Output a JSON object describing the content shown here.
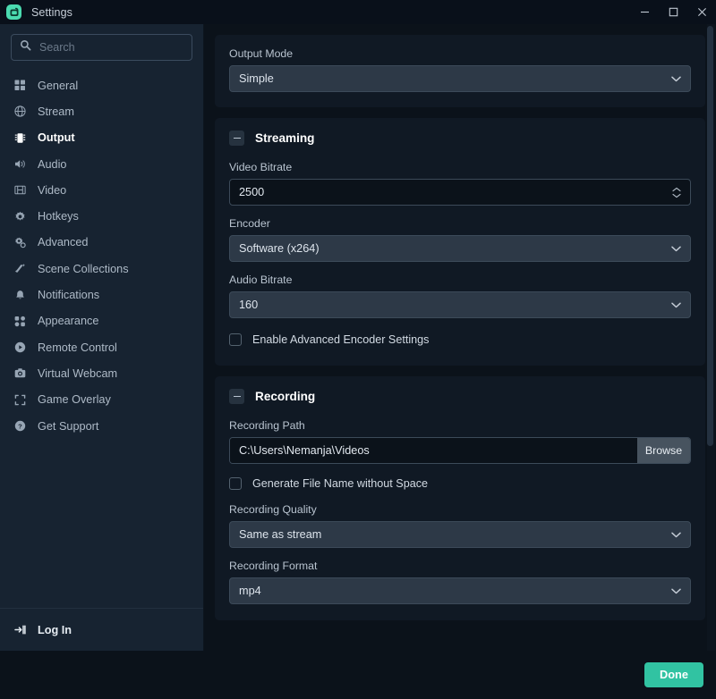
{
  "window": {
    "title": "Settings",
    "app_icon": "streamlabs-icon",
    "controls": {
      "minimize": "minimize-icon",
      "maximize": "maximize-icon",
      "close": "close-icon"
    },
    "accent": "#31c3a2",
    "background": "#0b121a",
    "sidebar_background": "#172331",
    "card_background": "#101924"
  },
  "sidebar": {
    "search": {
      "placeholder": "Search",
      "value": "",
      "icon": "search-icon"
    },
    "items": [
      {
        "label": "General",
        "icon": "grid-icon",
        "active": false
      },
      {
        "label": "Stream",
        "icon": "globe-icon",
        "active": false
      },
      {
        "label": "Output",
        "icon": "chip-icon",
        "active": true
      },
      {
        "label": "Audio",
        "icon": "speaker-icon",
        "active": false
      },
      {
        "label": "Video",
        "icon": "film-icon",
        "active": false
      },
      {
        "label": "Hotkeys",
        "icon": "gear-icon",
        "active": false
      },
      {
        "label": "Advanced",
        "icon": "sliders-gear-icon",
        "active": false
      },
      {
        "label": "Scene Collections",
        "icon": "wand-icon",
        "active": false
      },
      {
        "label": "Notifications",
        "icon": "bell-icon",
        "active": false
      },
      {
        "label": "Appearance",
        "icon": "layout-icon",
        "active": false
      },
      {
        "label": "Remote Control",
        "icon": "play-circle-icon",
        "active": false
      },
      {
        "label": "Virtual Webcam",
        "icon": "camera-icon",
        "active": false
      },
      {
        "label": "Game Overlay",
        "icon": "expand-icon",
        "active": false
      },
      {
        "label": "Get Support",
        "icon": "help-circle-icon",
        "active": false
      }
    ],
    "footer": {
      "label": "Log In",
      "icon": "login-icon"
    }
  },
  "main": {
    "output_mode": {
      "label": "Output Mode",
      "value": "Simple",
      "caret": "chevron-down-icon"
    },
    "streaming": {
      "title": "Streaming",
      "collapse_icon": "minus-icon",
      "video_bitrate": {
        "label": "Video Bitrate",
        "value": "2500",
        "spinner": "stepper-icon"
      },
      "encoder": {
        "label": "Encoder",
        "value": "Software (x264)",
        "caret": "chevron-down-icon"
      },
      "audio_bitrate": {
        "label": "Audio Bitrate",
        "value": "160",
        "caret": "chevron-down-icon"
      },
      "advanced_encoder": {
        "label": "Enable Advanced Encoder Settings",
        "checked": false
      }
    },
    "recording": {
      "title": "Recording",
      "collapse_icon": "minus-icon",
      "recording_path": {
        "label": "Recording Path",
        "value": "C:\\Users\\Nemanja\\Videos",
        "browse_label": "Browse"
      },
      "no_space": {
        "label": "Generate File Name without Space",
        "checked": false
      },
      "recording_quality": {
        "label": "Recording Quality",
        "value": "Same as stream",
        "caret": "chevron-down-icon"
      },
      "recording_format": {
        "label": "Recording Format",
        "value": "mp4",
        "caret": "chevron-down-icon"
      }
    }
  },
  "footer": {
    "done_label": "Done"
  }
}
